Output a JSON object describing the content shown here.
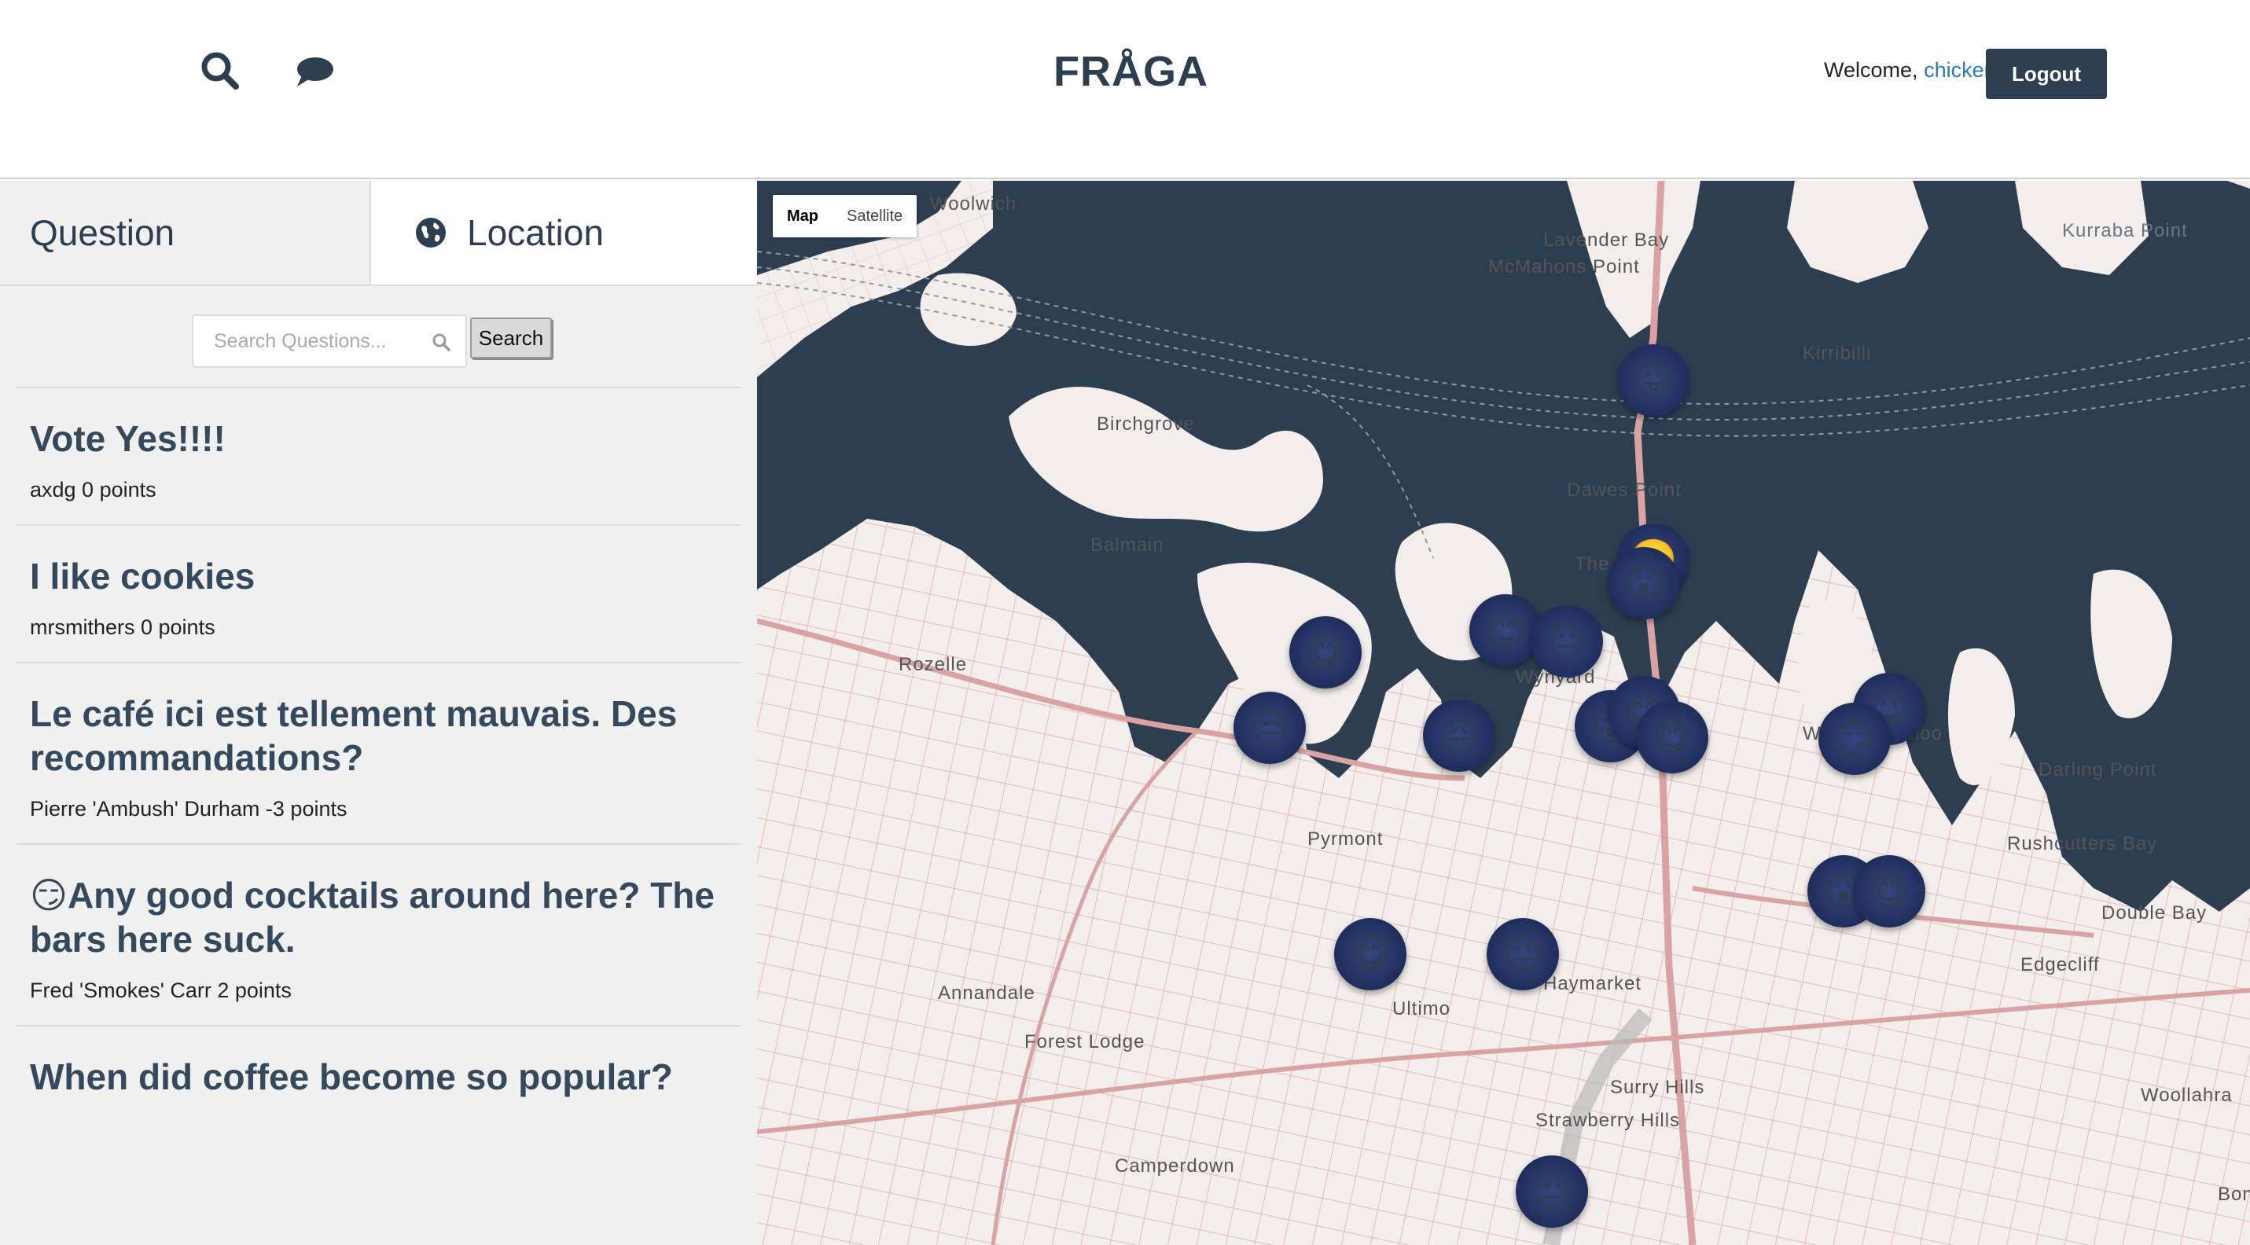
{
  "header": {
    "brand": "FRÅGA",
    "welcome_prefix": "Welcome,",
    "username": "chicken",
    "logout_label": "Logout",
    "icons": [
      "search-icon",
      "chat-bubble-icon"
    ]
  },
  "tabs": {
    "question": "Question",
    "location": "Location"
  },
  "search": {
    "placeholder": "Search Questions...",
    "button": "Search"
  },
  "questions": [
    {
      "title": "Vote Yes!!!!",
      "meta": "axdg 0 points"
    },
    {
      "title": "I like cookies",
      "meta": "mrsmithers 0 points"
    },
    {
      "title": " Le café ici est tellement mauvais. Des recommandations?",
      "meta": "Pierre 'Ambush' Durham -3 points"
    },
    {
      "title": "😏Any good cocktails around here? The bars here suck.",
      "meta": "Fred 'Smokes' Carr 2 points"
    },
    {
      "title": "When did coffee become so popular?",
      "meta": ""
    }
  ],
  "map": {
    "type_control": [
      "Map",
      "Satellite"
    ],
    "selected_type": "Map",
    "water_color": "#2c3e50",
    "land_color": "#f3eeec",
    "places": [
      "Woolwich",
      "Lavender Bay",
      "McMahons Point",
      "Kirribilli",
      "Kurraba Point",
      "Birchgrove",
      "Dawes Point",
      "Balmain",
      "Rozelle",
      "The Rocks",
      "Wynyard",
      "Pyrmont",
      "Woolloomooloo",
      "Darling Point",
      "Rushcutters Bay",
      "Double Bay",
      "Edgecliff",
      "Annandale",
      "Ultimo",
      "Haymarket",
      "Forest Lodge",
      "Surry Hills",
      "Strawberry Hills",
      "Camperdown",
      "Woollahra",
      "Bon"
    ],
    "markers": [
      "😛",
      "🙂",
      "😮",
      "😋",
      "😊",
      "😐",
      "😒",
      "😝",
      "😛",
      "😋",
      "😋",
      "😉",
      "😮",
      "😋",
      "😋",
      "😐",
      "😏",
      "😐"
    ]
  }
}
